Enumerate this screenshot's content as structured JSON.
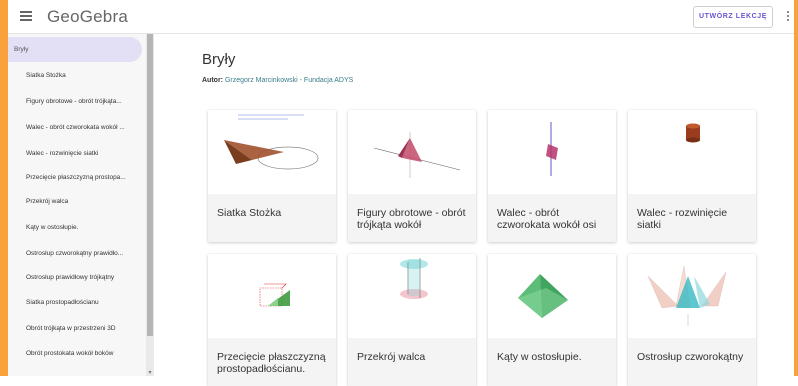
{
  "header": {
    "logo": "GeoGebra",
    "create_button": "UTWÓRZ LEKCJĘ"
  },
  "sidebar": {
    "items": [
      {
        "label": "Bryły"
      },
      {
        "label": "Siatka Stożka"
      },
      {
        "label": "Figury obrotowe - obrót trójkąta..."
      },
      {
        "label": "Walec - obrót czworokata wokół ..."
      },
      {
        "label": "Walec - rozwinięcie siatki"
      },
      {
        "label": "Przecięcie płaszczyzną prostopa..."
      },
      {
        "label": "Przekrój walca"
      },
      {
        "label": "Kąty w ostosłupie."
      },
      {
        "label": "Ostrosłup czworokątny prawidło..."
      },
      {
        "label": "Ostrosłup prawidłowy trójkątny"
      },
      {
        "label": "Siatka prostopadłościanu"
      },
      {
        "label": "Obrót trójkąta w przestrzeni 3D"
      },
      {
        "label": "Obrót prostokata wokół boków"
      }
    ]
  },
  "main": {
    "title": "Bryły",
    "author_label": "Autor:",
    "author_name": "Grzegorz Marcinkowski - Fundacja ADYS",
    "cards": [
      {
        "title": "Siatka Stożka",
        "icon": "cone-net-thumbnail"
      },
      {
        "title": "Figury obrotowe - obrót trójkąta wokół",
        "icon": "rotated-triangle-thumbnail"
      },
      {
        "title": "Walec - obrót czworokata wokół osi",
        "icon": "rotated-rectangle-thumbnail"
      },
      {
        "title": "Walec - rozwinięcie siatki",
        "icon": "cylinder-thumbnail"
      },
      {
        "title": "Przecięcie płaszczyzną prostopadłościanu.",
        "icon": "cuboid-section-thumbnail"
      },
      {
        "title": "Przekrój walca",
        "icon": "cylinder-section-thumbnail"
      },
      {
        "title": "Kąty w ostosłupie.",
        "icon": "pyramid-thumbnail"
      },
      {
        "title": "Ostrosłup czworokątny",
        "icon": "pyramid-net-thumbnail"
      }
    ]
  },
  "colors": {
    "accent": "#6557d2",
    "active_item": "#e3dff5",
    "link": "#3a7d8a",
    "frame_orange": "#f7a23b",
    "frame_purple": "#7b2fbf"
  }
}
